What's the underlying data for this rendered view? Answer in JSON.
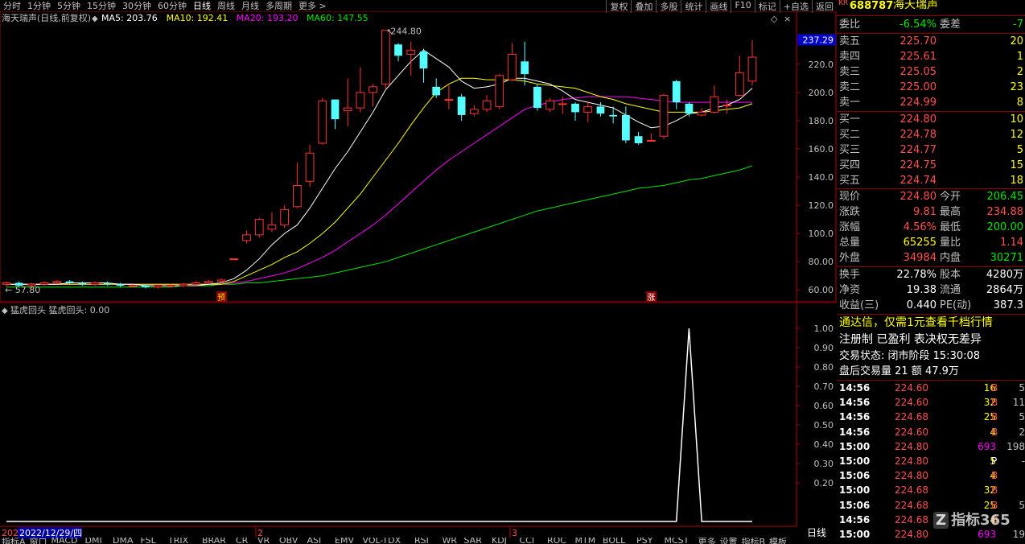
{
  "timeframes": [
    "分时",
    "1分钟",
    "5分钟",
    "15分钟",
    "30分钟",
    "60分钟",
    "日线",
    "周线",
    "月线",
    "多周期",
    "更多 >"
  ],
  "active_timeframe_index": 6,
  "tools": [
    "复权",
    "叠加",
    "多股",
    "统计",
    "画线",
    "F10",
    "标记",
    "+自选",
    "返回"
  ],
  "chart_title": "海天瑞声(日线,前复权)",
  "ma_labels": [
    {
      "text": "MA5: 203.76",
      "color": "#ffffff"
    },
    {
      "text": "MA10: 192.41",
      "color": "#ffff00"
    },
    {
      "text": "MA20: 193.20",
      "color": "#ff00ff"
    },
    {
      "text": "MA60: 147.55",
      "color": "#00e600"
    }
  ],
  "price_axis_labels": [
    "220.0",
    "200.0",
    "180.0",
    "160.0",
    "140.0",
    "120.0",
    "100.0",
    "80.00",
    "60.00"
  ],
  "current_price_tag": "237.29",
  "high_annotation": "244.80",
  "low_annotation": "57.80",
  "marker_pre": "预",
  "marker_up": "涨",
  "indicator_title": "猛虎回头  猛虎回头: 0.00",
  "indicator_axis_labels": [
    "1.00",
    "0.90",
    "0.80",
    "0.70",
    "0.60",
    "0.50",
    "0.40",
    "0.30",
    "0.20"
  ],
  "date_axis": {
    "left": "202",
    "highlight": "2022/12/29/四",
    "ticks": [
      "2",
      "3"
    ]
  },
  "period_label": "日线",
  "bottom_tabs": [
    "指标A",
    "窗口",
    "MACD",
    "DMI",
    "DMA",
    "FSL",
    "TRIX",
    "BRAR",
    "CR",
    "VR",
    "OBV",
    "ASI",
    "EMV",
    "VOL-TDX",
    "RSI",
    "WR",
    "SAR",
    "KDJ",
    "CCI",
    "ROC",
    "MTM",
    "BOLL",
    "PSY",
    "MCST",
    "更多",
    "设置",
    "指标B",
    "模板"
  ],
  "chart_data": {
    "type": "candlestick",
    "ylim": [
      55,
      245
    ],
    "x_labels": [
      "2022/12/29",
      "2",
      "3"
    ],
    "candles": [
      {
        "o": 64,
        "c": 65,
        "h": 66,
        "l": 62
      },
      {
        "o": 65,
        "c": 63,
        "h": 66,
        "l": 62
      },
      {
        "o": 63,
        "c": 64,
        "h": 65,
        "l": 61
      },
      {
        "o": 64,
        "c": 65,
        "h": 66,
        "l": 63
      },
      {
        "o": 65,
        "c": 66,
        "h": 67,
        "l": 64
      },
      {
        "o": 66,
        "c": 65,
        "h": 67,
        "l": 64
      },
      {
        "o": 65,
        "c": 64,
        "h": 66,
        "l": 63
      },
      {
        "o": 64,
        "c": 65,
        "h": 66,
        "l": 63
      },
      {
        "o": 65,
        "c": 64,
        "h": 66,
        "l": 63
      },
      {
        "o": 64,
        "c": 63,
        "h": 65,
        "l": 62
      },
      {
        "o": 63,
        "c": 63,
        "h": 64,
        "l": 62
      },
      {
        "o": 63,
        "c": 62,
        "h": 64,
        "l": 61
      },
      {
        "o": 62,
        "c": 63,
        "h": 64,
        "l": 61
      },
      {
        "o": 63,
        "c": 63,
        "h": 64,
        "l": 62
      },
      {
        "o": 63,
        "c": 64,
        "h": 65,
        "l": 62
      },
      {
        "o": 64,
        "c": 65,
        "h": 66,
        "l": 63
      },
      {
        "o": 65,
        "c": 66,
        "h": 67,
        "l": 64
      },
      {
        "o": 66,
        "c": 67,
        "h": 68,
        "l": 65
      },
      {
        "o": 82,
        "c": 82,
        "h": 82,
        "l": 82
      },
      {
        "o": 95,
        "c": 99,
        "h": 102,
        "l": 93
      },
      {
        "o": 99,
        "c": 110,
        "h": 111,
        "l": 97
      },
      {
        "o": 103,
        "c": 106,
        "h": 115,
        "l": 101
      },
      {
        "o": 106,
        "c": 117,
        "h": 120,
        "l": 104
      },
      {
        "o": 119,
        "c": 134,
        "h": 150,
        "l": 118
      },
      {
        "o": 137,
        "c": 157,
        "h": 163,
        "l": 133
      },
      {
        "o": 164,
        "c": 194,
        "h": 196,
        "l": 163
      },
      {
        "o": 195,
        "c": 181,
        "h": 195,
        "l": 174
      },
      {
        "o": 187,
        "c": 189,
        "h": 210,
        "l": 176
      },
      {
        "o": 189,
        "c": 200,
        "h": 218,
        "l": 186
      },
      {
        "o": 200,
        "c": 204,
        "h": 206,
        "l": 190
      },
      {
        "o": 206,
        "c": 244,
        "h": 244,
        "l": 202
      },
      {
        "o": 234,
        "c": 226,
        "h": 235,
        "l": 222
      },
      {
        "o": 227,
        "c": 230,
        "h": 236,
        "l": 212
      },
      {
        "o": 229,
        "c": 217,
        "h": 231,
        "l": 207
      },
      {
        "o": 204,
        "c": 198,
        "h": 210,
        "l": 196
      },
      {
        "o": 195,
        "c": 195,
        "h": 205,
        "l": 188
      },
      {
        "o": 197,
        "c": 184,
        "h": 199,
        "l": 180
      },
      {
        "o": 185,
        "c": 188,
        "h": 191,
        "l": 183
      },
      {
        "o": 188,
        "c": 194,
        "h": 198,
        "l": 186
      },
      {
        "o": 190,
        "c": 212,
        "h": 213,
        "l": 188
      },
      {
        "o": 209,
        "c": 227,
        "h": 235,
        "l": 208
      },
      {
        "o": 222,
        "c": 213,
        "h": 236,
        "l": 205
      },
      {
        "o": 204,
        "c": 189,
        "h": 206,
        "l": 187
      },
      {
        "o": 188,
        "c": 194,
        "h": 196,
        "l": 186
      },
      {
        "o": 192,
        "c": 192,
        "h": 197,
        "l": 185
      },
      {
        "o": 192,
        "c": 186,
        "h": 193,
        "l": 180
      },
      {
        "o": 186,
        "c": 190,
        "h": 194,
        "l": 179
      },
      {
        "o": 190,
        "c": 185,
        "h": 193,
        "l": 183
      },
      {
        "o": 184,
        "c": 183,
        "h": 190,
        "l": 178
      },
      {
        "o": 184,
        "c": 166,
        "h": 190,
        "l": 164
      },
      {
        "o": 169,
        "c": 164,
        "h": 172,
        "l": 163
      },
      {
        "o": 166,
        "c": 166,
        "h": 171,
        "l": 165
      },
      {
        "o": 169,
        "c": 198,
        "h": 199,
        "l": 167
      },
      {
        "o": 208,
        "c": 193,
        "h": 209,
        "l": 188
      },
      {
        "o": 192,
        "c": 185,
        "h": 193,
        "l": 183
      },
      {
        "o": 184,
        "c": 186,
        "h": 189,
        "l": 183
      },
      {
        "o": 186,
        "c": 197,
        "h": 205,
        "l": 185
      },
      {
        "o": 191,
        "c": 191,
        "h": 195,
        "l": 185
      },
      {
        "o": 198,
        "c": 214,
        "h": 226,
        "l": 197
      },
      {
        "o": 208,
        "c": 225,
        "h": 237,
        "l": 205
      }
    ],
    "ma5": [
      64,
      64,
      64,
      64,
      64,
      65,
      65,
      65,
      65,
      64,
      64,
      63,
      63,
      63,
      63,
      63,
      64,
      65,
      68,
      74,
      82,
      92,
      100,
      106,
      118,
      132,
      146,
      158,
      172,
      186,
      202,
      212,
      222,
      230,
      224,
      218,
      208,
      203,
      204,
      206,
      210,
      210,
      208,
      206,
      201,
      195,
      193,
      191,
      189,
      184,
      179,
      175,
      176,
      180,
      185,
      186,
      189,
      191,
      195,
      203
    ],
    "ma10": [
      64,
      64,
      64,
      64,
      64,
      64,
      64,
      64,
      64,
      64,
      64,
      64,
      64,
      64,
      64,
      64,
      64,
      64,
      66,
      70,
      74,
      78,
      83,
      87,
      93,
      100,
      108,
      118,
      128,
      140,
      152,
      164,
      177,
      189,
      200,
      206,
      210,
      210,
      209,
      209,
      209,
      208,
      206,
      205,
      204,
      203,
      200,
      197,
      195,
      192,
      190,
      188,
      186,
      186,
      186,
      186,
      187,
      188,
      189,
      192
    ],
    "ma20": [
      64,
      64,
      64,
      64,
      64,
      64,
      64,
      64,
      64,
      64,
      64,
      64,
      64,
      64,
      64,
      64,
      64,
      64,
      65,
      66,
      68,
      70,
      72,
      75,
      79,
      83,
      88,
      94,
      100,
      106,
      113,
      121,
      129,
      137,
      145,
      152,
      158,
      164,
      170,
      176,
      182,
      188,
      191,
      193,
      195,
      196,
      197,
      197,
      197,
      197,
      196,
      195,
      194,
      193,
      193,
      193,
      193,
      193,
      193,
      193
    ],
    "ma60": [
      62,
      62,
      62,
      62,
      62,
      62,
      62,
      62,
      62,
      62,
      62,
      62,
      62,
      62,
      63,
      63,
      63,
      64,
      64,
      65,
      65,
      66,
      67,
      68,
      69,
      70,
      72,
      74,
      76,
      78,
      80,
      83,
      86,
      89,
      92,
      95,
      98,
      101,
      104,
      107,
      110,
      113,
      116,
      118,
      120,
      122,
      124,
      126,
      128,
      130,
      132,
      133,
      134,
      136,
      138,
      139,
      141,
      143,
      145,
      148
    ],
    "indicator": [
      0,
      0,
      0,
      0,
      0,
      0,
      0,
      0,
      0,
      0,
      0,
      0,
      0,
      0,
      0,
      0,
      0,
      0,
      0,
      0,
      0,
      0,
      0,
      0,
      0,
      0,
      0,
      0,
      0,
      0,
      0,
      0,
      0,
      0,
      0,
      0,
      0,
      0,
      0,
      0,
      0,
      0,
      0,
      0,
      0,
      0,
      0,
      0,
      0,
      0,
      0,
      0,
      0,
      0,
      1,
      0,
      0,
      0,
      0,
      0
    ],
    "indicator_ylim": [
      0,
      1.05
    ]
  },
  "colors": {
    "up": "#ff3232",
    "down": "#54ffff",
    "ma5": "#ffffff",
    "ma10": "#ffff00",
    "ma20": "#ff00ff",
    "ma60": "#00e600",
    "axis": "#b00000"
  },
  "panel": {
    "code": "688787",
    "name": "海天瑞声",
    "kr": "KR",
    "weibi_label": "委比",
    "weibi": "-6.54%",
    "weicha_label": "委差",
    "weicha": "-7",
    "asks": [
      {
        "label": "卖五",
        "price": "225.70",
        "vol": "20"
      },
      {
        "label": "卖四",
        "price": "225.61",
        "vol": "1"
      },
      {
        "label": "卖三",
        "price": "225.05",
        "vol": "2"
      },
      {
        "label": "卖二",
        "price": "225.00",
        "vol": "23"
      },
      {
        "label": "卖一",
        "price": "224.99",
        "vol": "8"
      }
    ],
    "bids": [
      {
        "label": "买一",
        "price": "224.80",
        "vol": "10"
      },
      {
        "label": "买二",
        "price": "224.78",
        "vol": "12"
      },
      {
        "label": "买三",
        "price": "224.77",
        "vol": "5"
      },
      {
        "label": "买四",
        "price": "224.75",
        "vol": "15"
      },
      {
        "label": "买五",
        "price": "224.74",
        "vol": "18"
      }
    ],
    "stats": [
      {
        "l1": "现价",
        "v1": "224.80",
        "c1": "red",
        "l2": "今开",
        "v2": "206.45",
        "c2": "grn"
      },
      {
        "l1": "涨跌",
        "v1": "9.81",
        "c1": "red",
        "l2": "最高",
        "v2": "234.88",
        "c2": "red"
      },
      {
        "l1": "涨幅",
        "v1": "4.56%",
        "c1": "red",
        "l2": "最低",
        "v2": "200.00",
        "c2": "grn"
      },
      {
        "l1": "总量",
        "v1": "65255",
        "c1": "yel",
        "l2": "量比",
        "v2": "1.14",
        "c2": "red"
      },
      {
        "l1": "外盘",
        "v1": "34984",
        "c1": "red",
        "l2": "内盘",
        "v2": "30271",
        "c2": "grn"
      }
    ],
    "stats2": [
      {
        "l1": "换手",
        "v1": "22.78%",
        "l2": "股本",
        "v2": "4280万"
      },
      {
        "l1": "净资",
        "v1": "19.38",
        "l2": "流通",
        "v2": "2864万"
      },
      {
        "l1": "收益(三)",
        "v1": "0.440",
        "l2": "PE(动)",
        "v2": "387.3"
      }
    ],
    "promo": "通达信，仅需1元查看千档行情",
    "reg": "注册制 已盈利 表决权无差异",
    "trade_status": "交易状态: 闭市阶段 15:30:08",
    "after_hours": "盘后交易量 21 额 47.9万",
    "ticks": [
      {
        "t": "14:56",
        "p": "224.60",
        "v": "16",
        "vc": "yel",
        "bs": "B",
        "bsc": "red",
        "n": "5"
      },
      {
        "t": "14:56",
        "p": "224.60",
        "v": "32",
        "vc": "yel",
        "bs": "B",
        "bsc": "red",
        "n": "11"
      },
      {
        "t": "14:56",
        "p": "224.68",
        "v": "25",
        "vc": "yel",
        "bs": "B",
        "bsc": "red",
        "n": "5"
      },
      {
        "t": "14:56",
        "p": "224.60",
        "v": "4",
        "vc": "yel",
        "bs": "B",
        "bsc": "red",
        "n": "2"
      },
      {
        "t": "15:00",
        "p": "224.80",
        "v": "693",
        "vc": "mag",
        "bs": "",
        "bsc": "red",
        "n": "198"
      },
      {
        "t": "15:00",
        "p": "224.80",
        "v": "5",
        "vc": "yel",
        "bs": "P",
        "bsc": "wht",
        "n": "-"
      },
      {
        "t": "15:06",
        "p": "224.80",
        "v": "4",
        "vc": "yel",
        "bs": "B",
        "bsc": "red",
        "n": ""
      },
      {
        "t": "15:00",
        "p": "224.68",
        "v": "32",
        "vc": "yel",
        "bs": "B",
        "bsc": "red",
        "n": ""
      },
      {
        "t": "15:06",
        "p": "224.68",
        "v": "25",
        "vc": "yel",
        "bs": "B",
        "bsc": "red",
        "n": "5"
      },
      {
        "t": "14:56",
        "p": "224.68",
        "v": "4",
        "vc": "yel",
        "bs": "B",
        "bsc": "red",
        "n": ""
      },
      {
        "t": "15:00",
        "p": "224.80",
        "v": "693",
        "vc": "mag",
        "bs": "",
        "bsc": "red",
        "n": "19"
      }
    ],
    "watermark": "指标365"
  }
}
